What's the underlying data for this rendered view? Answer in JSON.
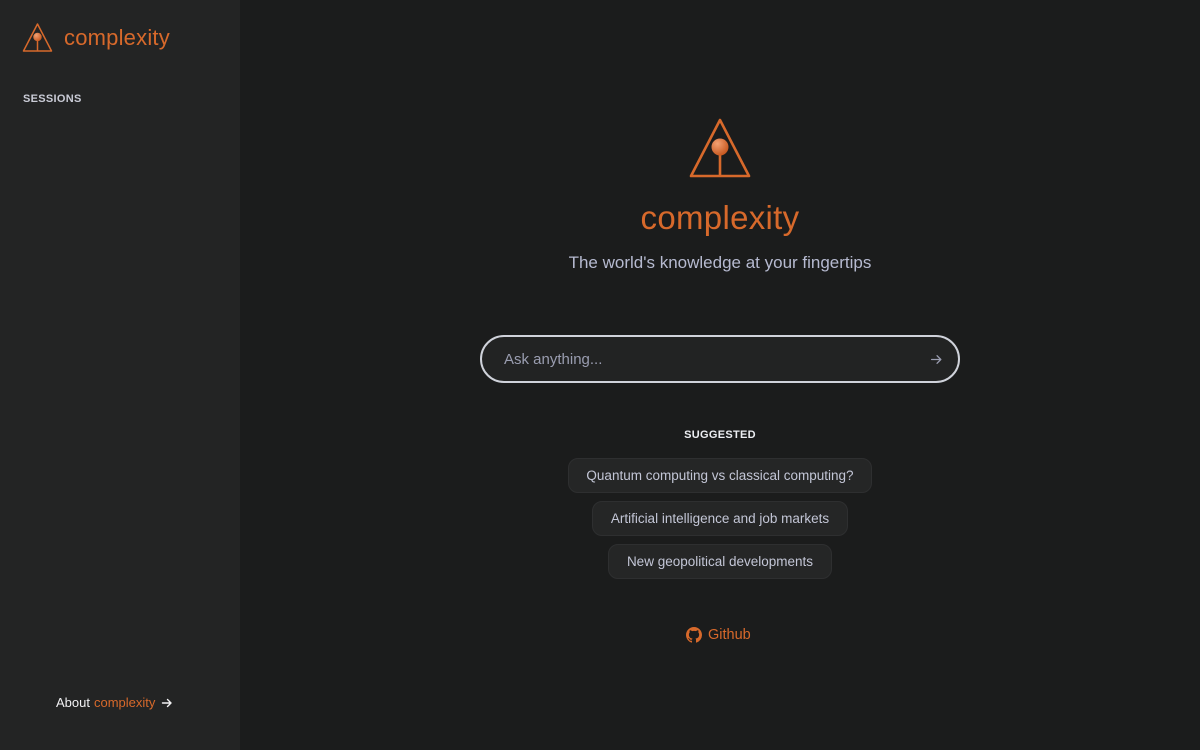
{
  "sidebar": {
    "brand_name": "complexity",
    "sessions_label": "SESSIONS",
    "about_prefix": "About",
    "about_brand": "complexity"
  },
  "hero": {
    "title": "complexity",
    "subtitle": "The world's knowledge at your fingertips"
  },
  "search": {
    "placeholder": "Ask anything...",
    "value": ""
  },
  "suggested": {
    "label": "SUGGESTED",
    "items": [
      "Quantum computing vs classical computing?",
      "Artificial intelligence and job markets",
      "New geopolitical developments"
    ]
  },
  "footer": {
    "github_label": "Github"
  },
  "icons": {
    "logo": "triangle-pin-logo-icon",
    "submit": "arrow-right-icon",
    "about_arrow": "arrow-right-icon",
    "github": "github-icon"
  },
  "colors": {
    "background": "#1b1c1c",
    "sidebar": "#232424",
    "accent": "#d7692b",
    "subtitle": "#b6bad0"
  }
}
